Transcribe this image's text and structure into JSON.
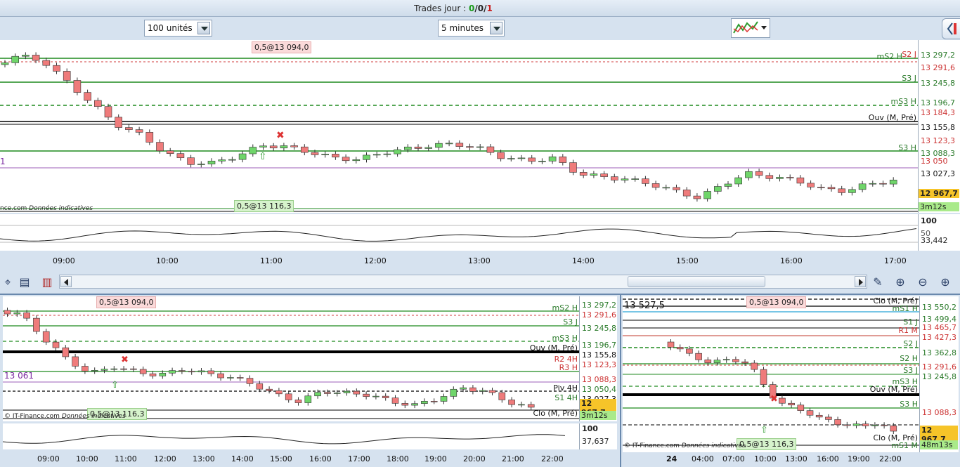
{
  "header": {
    "trades_label": "Trades jour :",
    "trades_win": "0",
    "trades_sep1": "/",
    "trades_neutral": "0",
    "trades_sep2": "/",
    "trades_loss": "1"
  },
  "toolbar": {
    "units_value": "100 unités",
    "interval_value": "5 minutes",
    "chart_type_icon": "chart-style-icon",
    "side_panel_icon": "side-panel-icon"
  },
  "main_chart": {
    "order_tag_sell": "0,5@13 094,0",
    "order_tag_buy": "0,5@13 116,3",
    "left_value": "1",
    "credit_text": "nce.com",
    "credit_italic": "Données indicatives",
    "line_labels": [
      "S2 J",
      "mS2 H",
      "S3 J",
      "mS3 H",
      "Ouv (M, Pré)",
      "S3 H"
    ],
    "price_labels": [
      "13 297,2",
      "13 291,6",
      "13 245,8",
      "13 196,7",
      "13 184,3",
      "13 155,8",
      "13 123,3",
      "13 088,3",
      "13 050",
      "13 027,3"
    ],
    "current_price": "12 967,7",
    "timer": "3m12s",
    "osc_top": "100",
    "osc_mid": "50",
    "osc_value": "33,442",
    "time_labels": [
      "09:00",
      "10:00",
      "11:00",
      "12:00",
      "13:00",
      "14:00",
      "15:00",
      "16:00",
      "17:00"
    ]
  },
  "bottom_left": {
    "order_tag_sell": "0,5@13 094,0",
    "order_tag_buy": "0,5@13 116,3",
    "left_value": "13 061",
    "credit_text": "© IT-Finance.com",
    "credit_italic": "Données indicatives",
    "line_labels": [
      "mS2 H",
      "S3 J",
      "mS3 H",
      "Ouv (M, Pré)",
      "R2 4H",
      "R3 H",
      "Piv 4H",
      "S1 4H",
      "Clo (M, Pré)"
    ],
    "price_labels": [
      "13 297,2",
      "13 291,6",
      "13 245,8",
      "13 196,7",
      "13 155,8",
      "13 123,3",
      "13 088,3",
      "13 050,4",
      "13 027,3"
    ],
    "current_price": "12 967,7",
    "timer": "3m12s",
    "osc_top": "100",
    "osc_value": "37,637",
    "time_labels": [
      "09:00",
      "10:00",
      "11:00",
      "12:00",
      "13:00",
      "14:00",
      "15:00",
      "16:00",
      "17:00",
      "18:00",
      "19:00",
      "20:00",
      "21:00",
      "22:00"
    ]
  },
  "bottom_right": {
    "order_tag_sell": "0,5@13 094,0",
    "order_tag_buy": "0,5@13 116,3",
    "left_value": "13 527,5",
    "credit_text": "© IT-Finance.com",
    "credit_italic": "Données indicatives",
    "line_labels": [
      "Clo (M, Pré)",
      "mS1 H",
      "S1 J",
      "R1 M",
      "S2 J",
      "S2 H",
      "S3 J",
      "mS3 H",
      "Ouv (M, Pré)",
      "S3 H",
      "Clo (M, Pré)",
      "mS1 M"
    ],
    "price_labels": [
      "13 550,2",
      "13 499,4",
      "13 465,7",
      "13 427,3",
      "13 362,8",
      "13 291,6",
      "13 245,8",
      "13 088,3"
    ],
    "current_price": "12 967,7",
    "timer": "48m13s",
    "time_labels": [
      "24",
      "04:00",
      "07:00",
      "10:00",
      "13:00",
      "16:00",
      "19:00",
      "22:00"
    ]
  },
  "colors": {
    "up_candle": "#6fd56a",
    "down_candle": "#ef7b7b",
    "support_line": "#1f8a1f",
    "resistance_line": "#d23c3c",
    "pivot_line": "#000000",
    "current_price_bg": "#f6c429",
    "timer_bg": "#a9ea8a"
  }
}
